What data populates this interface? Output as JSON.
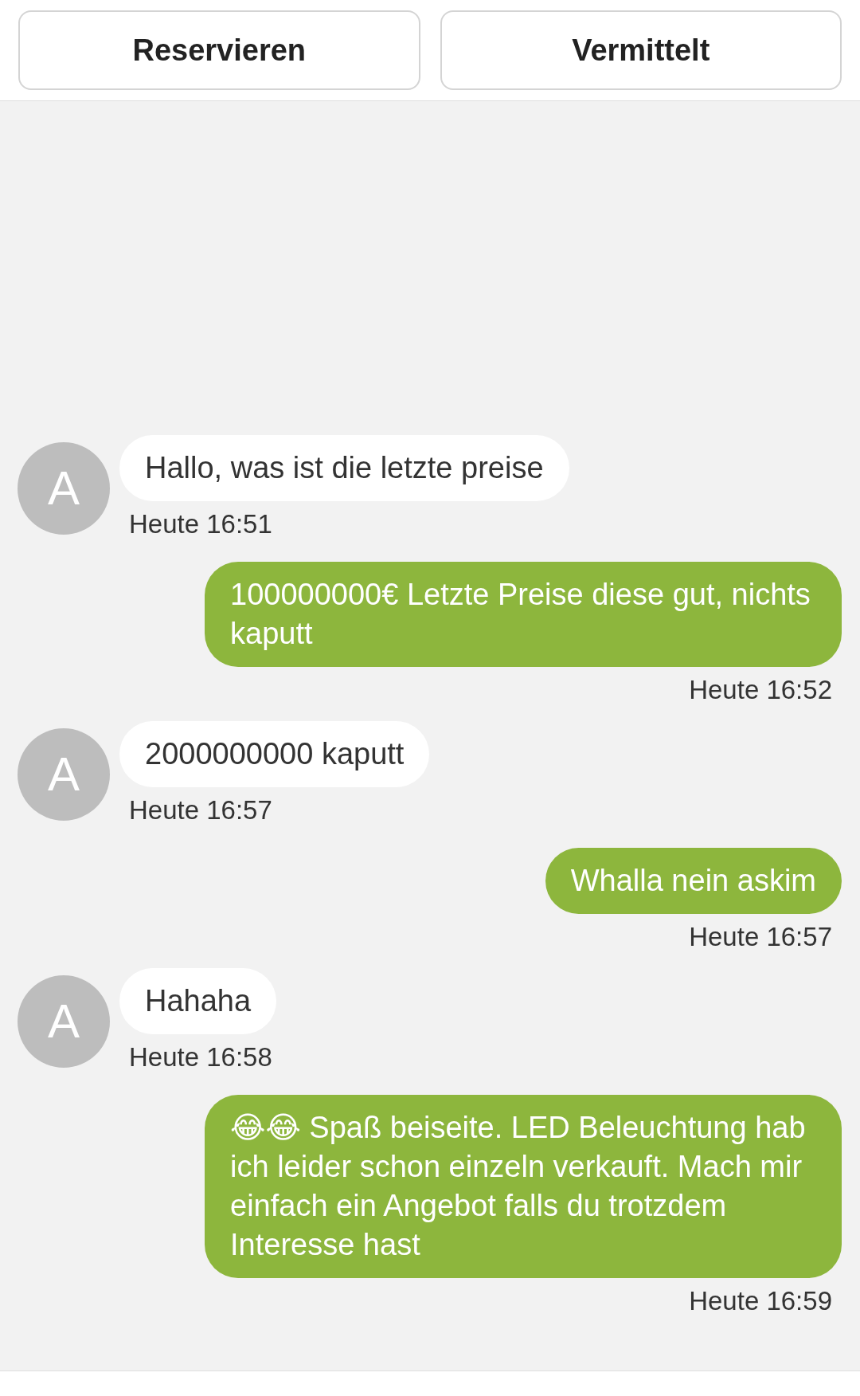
{
  "header": {
    "buttons": [
      "Reservieren",
      "Vermittelt"
    ]
  },
  "messages": [
    {
      "kind": "incoming",
      "avatar": "A",
      "text": "Hallo, was ist die letzte preise",
      "time": "Heute 16:51"
    },
    {
      "kind": "outgoing",
      "text": "100000000€ Letzte Preise diese gut, nichts kaputt",
      "time": "Heute 16:52"
    },
    {
      "kind": "incoming",
      "avatar": "A",
      "text": "2000000000 kaputt",
      "time": "Heute 16:57"
    },
    {
      "kind": "outgoing",
      "text": "Whalla nein askim",
      "time": "Heute 16:57"
    },
    {
      "kind": "incoming",
      "avatar": "A",
      "text": "Hahaha",
      "time": "Heute 16:58"
    },
    {
      "kind": "outgoing",
      "text": "😂😂 Spaß beiseite. LED Beleuchtung hab ich leider schon einzeln verkauft. Mach mir einfach ein Angebot falls du trotzdem Interesse hast",
      "time": "Heute 16:59"
    }
  ]
}
